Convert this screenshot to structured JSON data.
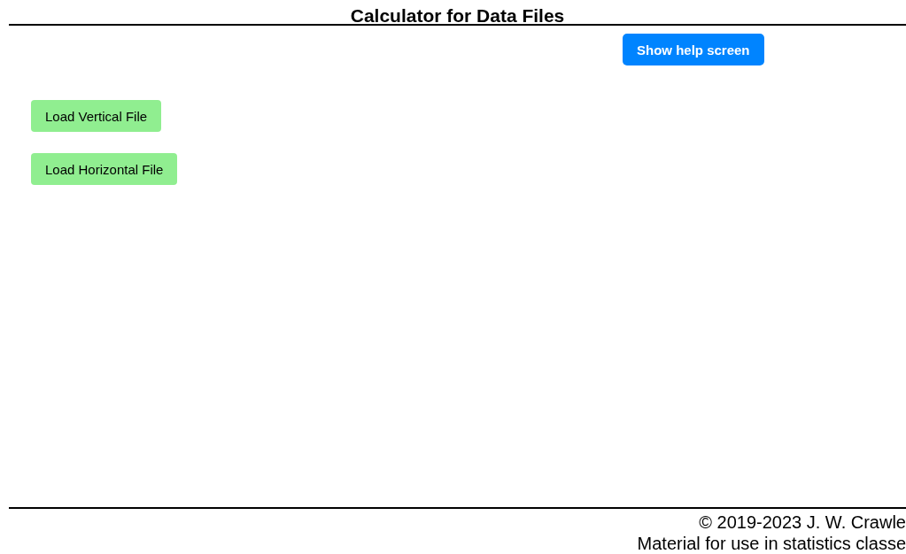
{
  "header": {
    "title": "Calculator for Data Files"
  },
  "help_button": {
    "label": "Show help screen"
  },
  "load_buttons": [
    {
      "label": "Load Vertical File"
    },
    {
      "label": "Load Horizontal File"
    }
  ],
  "footer": {
    "lines": [
      "© 2019-2023 J. W. Crawle",
      "Material for use in statistics classe"
    ]
  }
}
